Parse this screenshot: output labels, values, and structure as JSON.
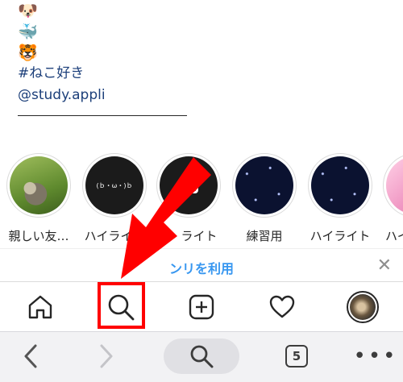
{
  "profile_bio": {
    "emojis": [
      "🐶",
      "🐳",
      "🐯"
    ],
    "hashtag": "#ねこ好き",
    "mention": "@study.appli"
  },
  "highlights": [
    {
      "label": "親しい友…",
      "image": "cat-photo"
    },
    {
      "label": "ハイライト",
      "image": "text-on-black",
      "overlay_text": "(ｂ・ω・)ｂ"
    },
    {
      "label": "ライト",
      "image": "camera-on-black"
    },
    {
      "label": "練習用",
      "image": "night-sky"
    },
    {
      "label": "ハイライト",
      "image": "night-sky"
    },
    {
      "label": "ハイ",
      "image": "pink"
    }
  ],
  "app_banner": {
    "text": "ンリを利用",
    "close_icon": "close-icon"
  },
  "insta_nav": {
    "items": [
      "home-icon",
      "search-icon",
      "new-post-icon",
      "activity-heart-icon",
      "profile-avatar"
    ],
    "highlighted_item": "search-icon",
    "annotation_color": "#ff0000"
  },
  "browser_toolbar": {
    "items": [
      "back-icon",
      "forward-icon",
      "search-icon",
      "tabs-icon",
      "more-icon"
    ],
    "tab_count": "5"
  },
  "colors": {
    "link_blue": "#3897f0",
    "annotation_red": "#ff0000",
    "text": "#262626"
  }
}
